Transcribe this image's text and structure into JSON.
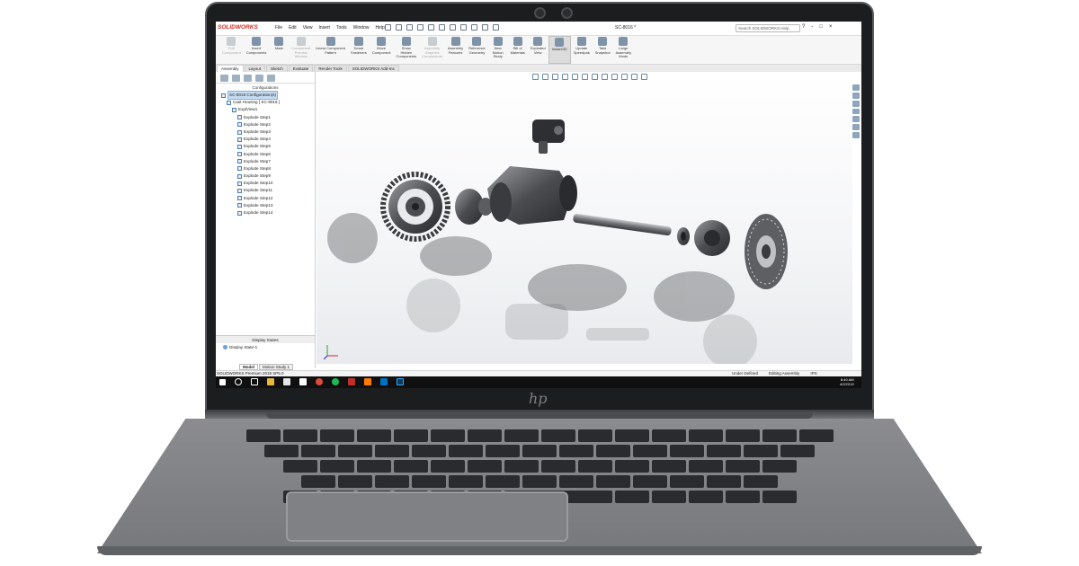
{
  "app": {
    "logo_text": "SOLIDWORKS",
    "menu": [
      "File",
      "Edit",
      "View",
      "Insert",
      "Tools",
      "Window",
      "Help"
    ],
    "document_title": "SC-8016 *",
    "search_placeholder": "Search SOLIDWORKS Help",
    "window_controls": [
      "?",
      "-",
      "□",
      "×"
    ]
  },
  "ribbon": {
    "buttons": [
      {
        "label": "Edit\nComponent",
        "disabled": true
      },
      {
        "label": "Insert\nComponents",
        "disabled": false
      },
      {
        "label": "Mate",
        "disabled": false
      },
      {
        "label": "Component\nPreview\nWindow",
        "disabled": true
      },
      {
        "label": "Linear Component\nPattern",
        "disabled": false
      },
      {
        "label": "Smart\nFasteners",
        "disabled": false
      },
      {
        "label": "Move\nComponent",
        "disabled": false
      },
      {
        "label": "Show\nHidden\nComponents",
        "disabled": false
      },
      {
        "label": "Assembly\nGraphics\nComponents",
        "disabled": true
      },
      {
        "label": "Assembly\nFeatures",
        "disabled": false
      },
      {
        "label": "Reference\nGeometry",
        "disabled": false
      },
      {
        "label": "New\nMotion\nStudy",
        "disabled": false
      },
      {
        "label": "Bill of\nMaterials",
        "disabled": false
      },
      {
        "label": "Exploded\nView",
        "disabled": false
      },
      {
        "label": "Instant3D",
        "disabled": false,
        "active": true
      },
      {
        "label": "Update\nSpeedpak",
        "disabled": false
      },
      {
        "label": "Take\nSnapshot",
        "disabled": false
      },
      {
        "label": "Large\nAssembly\nMode",
        "disabled": false
      }
    ]
  },
  "command_tabs": [
    "Assembly",
    "Layout",
    "Sketch",
    "Evaluate",
    "Render Tools",
    "SOLIDWORKS Add-Ins"
  ],
  "config_manager": {
    "title": "Configurations",
    "tree": [
      {
        "label": "SC-8016 Configuration(s)",
        "indent": 0,
        "selected": true
      },
      {
        "label": "Cast Housing [ SC-8016 ]",
        "indent": 1
      },
      {
        "label": "ExplView1",
        "indent": 2
      },
      {
        "label": "Explode Step1",
        "indent": 3
      },
      {
        "label": "Explode Step2",
        "indent": 3
      },
      {
        "label": "Explode Step3",
        "indent": 3
      },
      {
        "label": "Explode Step4",
        "indent": 3
      },
      {
        "label": "Explode Step5",
        "indent": 3
      },
      {
        "label": "Explode Step6",
        "indent": 3
      },
      {
        "label": "Explode Step7",
        "indent": 3
      },
      {
        "label": "Explode Step8",
        "indent": 3
      },
      {
        "label": "Explode Step9",
        "indent": 3
      },
      {
        "label": "Explode Step10",
        "indent": 3
      },
      {
        "label": "Explode Step11",
        "indent": 3
      },
      {
        "label": "Explode Step12",
        "indent": 3
      },
      {
        "label": "Explode Step13",
        "indent": 3
      },
      {
        "label": "Explode Step14",
        "indent": 3
      }
    ],
    "display_states_title": "Display States",
    "display_state": "Display State-1"
  },
  "bottom_tabs": [
    "Model",
    "Motion Study 1"
  ],
  "status_bar": {
    "left": "SOLIDWORKS Premium 2018 SP5.0",
    "state": "Under Defined",
    "mode": "Editing Assembly",
    "units": "IPS"
  },
  "taskbar": {
    "time": "8:40 AM",
    "date": "4/2/2019",
    "icons": [
      "windows-start-icon",
      "search-icon",
      "task-view-icon",
      "file-explorer-icon",
      "store-icon",
      "mail-icon",
      "chrome-icon",
      "spotify-icon",
      "solidworks-icon",
      "illustrator-icon",
      "outlook-icon",
      "photoshop-icon"
    ]
  },
  "hardware": {
    "brand_logo": "hp"
  },
  "colors": {
    "solidworks_red": "#d32c24",
    "selection_blue": "#c6dcf2",
    "taskbar": "#101010"
  }
}
